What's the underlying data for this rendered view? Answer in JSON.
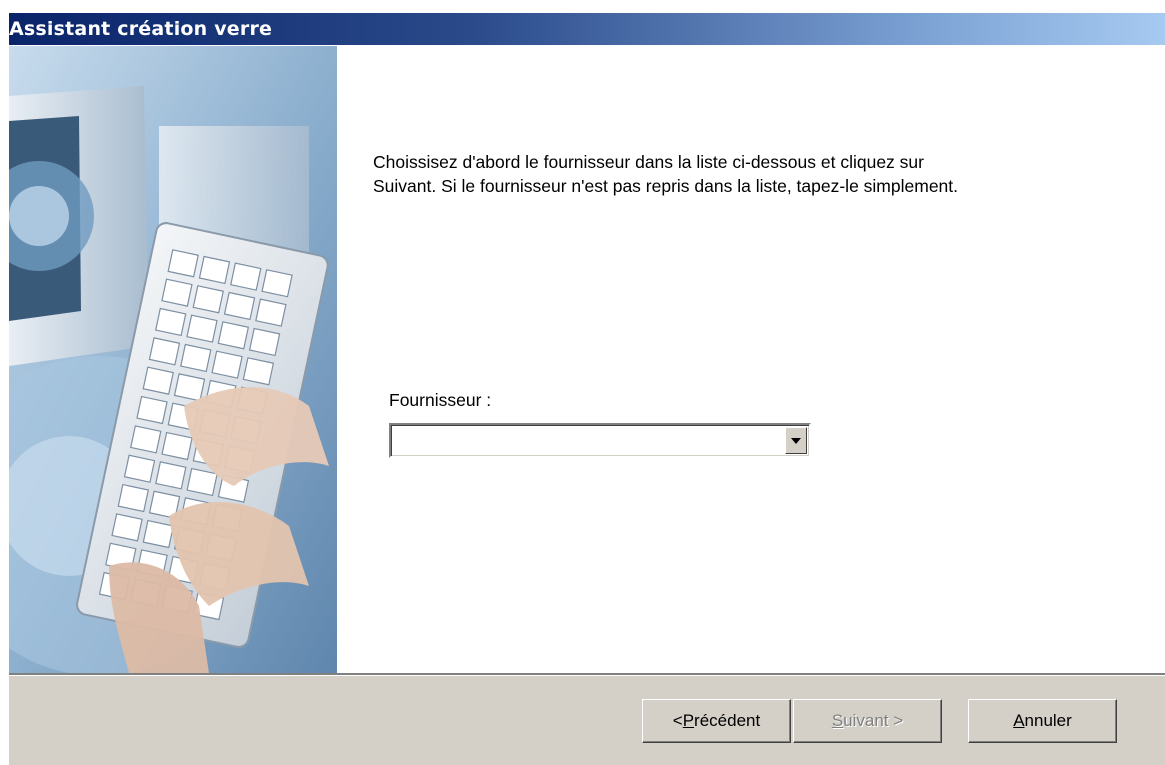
{
  "window": {
    "title": "Assistant création verre"
  },
  "content": {
    "intro_line1": "Choissisez d'abord le fournisseur dans la liste ci-dessous et cliquez sur",
    "intro_line2": "Suivant. Si le fournisseur n'est pas repris dans la liste, tapez-le simplement.",
    "supplier_label": "Fournisseur :",
    "supplier_value": ""
  },
  "buttons": {
    "previous_prefix": "< ",
    "previous_mnemonic": "P",
    "previous_rest": "récédent",
    "next_mnemonic": "S",
    "next_rest": "uivant >",
    "next_enabled": false,
    "cancel_mnemonic": "A",
    "cancel_rest": "nnuler"
  },
  "image": {
    "subject": "hands-typing-on-keyboard-with-monitor"
  },
  "colors": {
    "titlebar_start": "#0a246a",
    "titlebar_end": "#a6caf0",
    "dialog_bg": "#d4d0c8",
    "image_tint": "#8fb0cc"
  }
}
